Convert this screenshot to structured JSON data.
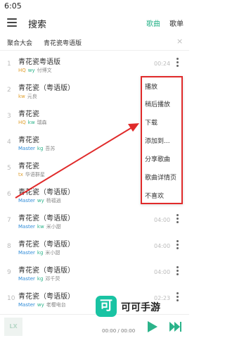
{
  "status_bar": {
    "time": "6:05"
  },
  "app_bar": {
    "title": "搜索",
    "tabs": [
      {
        "label": "歌曲",
        "active": true
      },
      {
        "label": "歌单",
        "active": false
      }
    ]
  },
  "search": {
    "source": "聚合大会",
    "query": "青花瓷粤语版",
    "clear_icon": "×"
  },
  "colors": {
    "accent": "#2bb38a",
    "highlight_border": "#e02a2a",
    "arrow": "#e02a2a"
  },
  "songs": [
    {
      "index": "1",
      "title": "青花瓷粤语版",
      "tags": [
        {
          "text": "HQ",
          "color": "orange"
        },
        {
          "text": "wy",
          "color": "green"
        }
      ],
      "artist": "付博文",
      "duration": "00:24"
    },
    {
      "index": "2",
      "title": "青花瓷（粤语版）",
      "tags": [
        {
          "text": "kw",
          "color": "orange"
        }
      ],
      "artist": "元良",
      "duration": ""
    },
    {
      "index": "3",
      "title": "青花瓷",
      "tags": [
        {
          "text": "HQ",
          "color": "orange"
        },
        {
          "text": "kw",
          "color": "green"
        }
      ],
      "artist": "瑞森",
      "duration": ""
    },
    {
      "index": "4",
      "title": "青花瓷",
      "tags": [
        {
          "text": "Master",
          "color": "blue"
        },
        {
          "text": "kg",
          "color": "green"
        }
      ],
      "artist": "吾苏",
      "duration": ""
    },
    {
      "index": "5",
      "title": "青花瓷",
      "tags": [
        {
          "text": "tx",
          "color": "orange"
        }
      ],
      "artist": "华语群星",
      "duration": ""
    },
    {
      "index": "6",
      "title": "青花瓷（粤语版）",
      "tags": [
        {
          "text": "Master",
          "color": "blue"
        },
        {
          "text": "wy",
          "color": "green"
        }
      ],
      "artist": "杨福逍",
      "duration": ""
    },
    {
      "index": "7",
      "title": "青花瓷（粤语版）",
      "tags": [
        {
          "text": "Master",
          "color": "blue"
        },
        {
          "text": "kw",
          "color": "green"
        }
      ],
      "artist": "米小甜",
      "duration": "04:00"
    },
    {
      "index": "8",
      "title": "青花瓷（粤语版）",
      "tags": [
        {
          "text": "Master",
          "color": "blue"
        },
        {
          "text": "kg",
          "color": "green"
        }
      ],
      "artist": "米小甜",
      "duration": "04:00"
    },
    {
      "index": "9",
      "title": "青花瓷（粤语版）",
      "tags": [
        {
          "text": "Master",
          "color": "blue"
        },
        {
          "text": "kg",
          "color": "green"
        }
      ],
      "artist": "邓千荧",
      "duration": "04:00"
    },
    {
      "index": "10",
      "title": "青花瓷（粤语版）",
      "tags": [
        {
          "text": "Master",
          "color": "blue"
        },
        {
          "text": "wy",
          "color": "green"
        }
      ],
      "artist": "老樱电台",
      "duration": "02:23"
    }
  ],
  "context_menu": {
    "items": [
      "播放",
      "稍后播放",
      "下载",
      "添加到...",
      "分享歌曲",
      "歌曲详情页",
      "不喜欢"
    ]
  },
  "player": {
    "cover_text": "LX",
    "time": "00:00 / 00:00"
  },
  "watermark": {
    "logo_char": "可",
    "text": "可可手游"
  }
}
